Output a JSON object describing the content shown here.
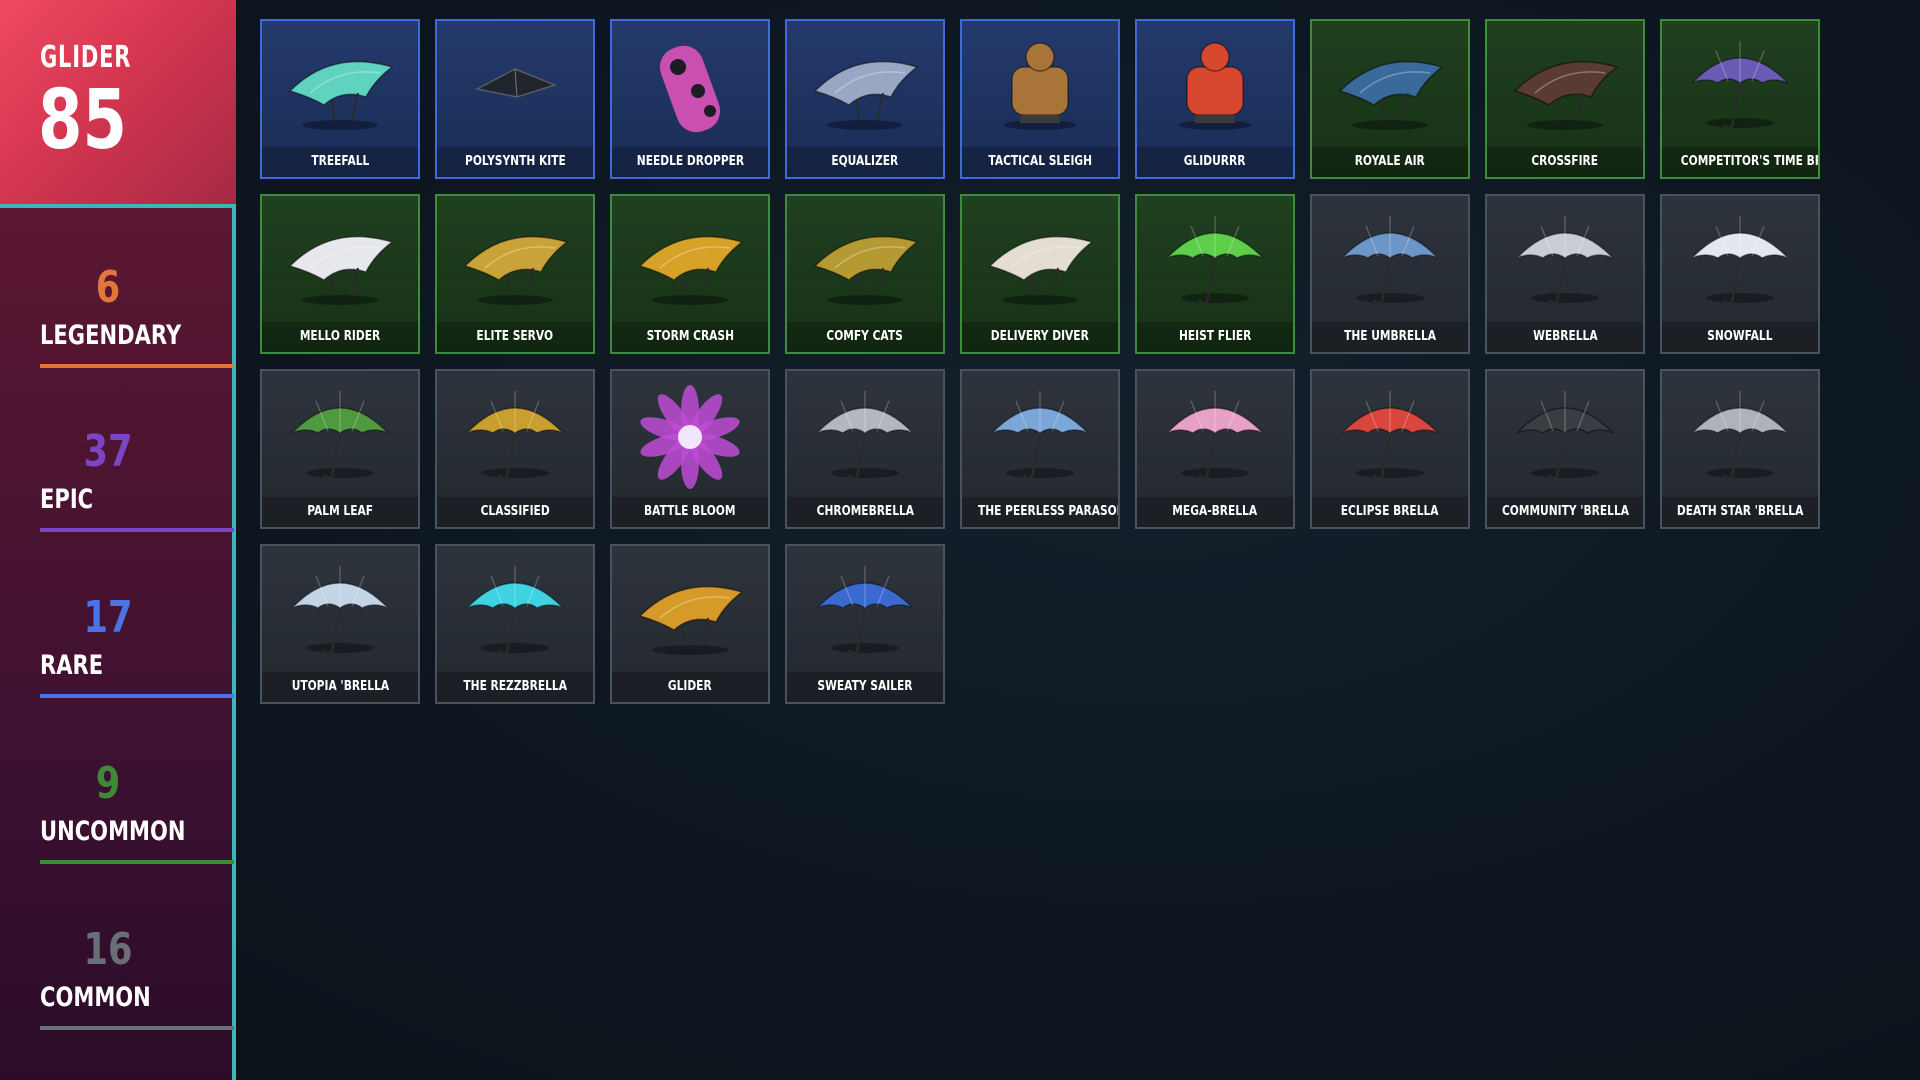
{
  "summary": {
    "label": "GLIDER",
    "total": "85"
  },
  "rarities": [
    {
      "count": "6",
      "label": "LEGENDARY",
      "color": "#e2763a"
    },
    {
      "count": "37",
      "label": "EPIC",
      "color": "#7a45c6"
    },
    {
      "count": "17",
      "label": "RARE",
      "color": "#4a74e6"
    },
    {
      "count": "9",
      "label": "UNCOMMON",
      "color": "#3f8a36"
    },
    {
      "count": "16",
      "label": "COMMON",
      "color": "#6a6f75"
    }
  ],
  "items": [
    {
      "name": "TREEFALL",
      "rarity": "rare",
      "icon": "glider-icon",
      "color": "#5fd3c0"
    },
    {
      "name": "POLYSYNTH KITE",
      "rarity": "rare",
      "icon": "kite-icon",
      "color": "#20242c"
    },
    {
      "name": "NEEDLE DROPPER",
      "rarity": "rare",
      "icon": "board-icon",
      "color": "#c94fb0"
    },
    {
      "name": "EQUALIZER",
      "rarity": "rare",
      "icon": "glider-icon",
      "color": "#9aa7c4"
    },
    {
      "name": "TACTICAL SLEIGH",
      "rarity": "rare",
      "icon": "sleigh-icon",
      "color": "#a8743a"
    },
    {
      "name": "GLIDURRR",
      "rarity": "rare",
      "icon": "sleigh-icon",
      "color": "#d7482e"
    },
    {
      "name": "ROYALE AIR",
      "rarity": "uncommon",
      "icon": "glider-icon",
      "color": "#3a6a9a"
    },
    {
      "name": "CROSSFIRE",
      "rarity": "uncommon",
      "icon": "glider-icon",
      "color": "#5a3a34"
    },
    {
      "name": "COMPETITOR'S TIME BRELLA",
      "rarity": "uncommon",
      "icon": "umbrella-icon",
      "color": "#6a5ab4"
    },
    {
      "name": "MELLO RIDER",
      "rarity": "uncommon",
      "icon": "glider-icon",
      "color": "#e6e8ec"
    },
    {
      "name": "ELITE SERVO",
      "rarity": "uncommon",
      "icon": "glider-icon",
      "color": "#c9a23a"
    },
    {
      "name": "STORM CRASH",
      "rarity": "uncommon",
      "icon": "glider-icon",
      "color": "#d6a328"
    },
    {
      "name": "COMFY CATS",
      "rarity": "uncommon",
      "icon": "glider-icon",
      "color": "#b59a34"
    },
    {
      "name": "DELIVERY DIVER",
      "rarity": "uncommon",
      "icon": "glider-icon",
      "color": "#e3ddd2"
    },
    {
      "name": "HEIST FLIER",
      "rarity": "uncommon",
      "icon": "umbrella-icon",
      "color": "#5ecf4a"
    },
    {
      "name": "THE UMBRELLA",
      "rarity": "common",
      "icon": "umbrella-icon",
      "color": "#6d96c8"
    },
    {
      "name": "WEBRELLA",
      "rarity": "common",
      "icon": "umbrella-icon",
      "color": "#c9ccd2"
    },
    {
      "name": "SNOWFALL",
      "rarity": "common",
      "icon": "umbrella-icon",
      "color": "#e4e8ee"
    },
    {
      "name": "PALM LEAF",
      "rarity": "common",
      "icon": "umbrella-icon",
      "color": "#4f9a3e"
    },
    {
      "name": "CLASSIFIED",
      "rarity": "common",
      "icon": "umbrella-icon",
      "color": "#c9a030"
    },
    {
      "name": "BATTLE BLOOM",
      "rarity": "common",
      "icon": "flower-icon",
      "color": "#c04cd6"
    },
    {
      "name": "CHROMEBRELLA",
      "rarity": "common",
      "icon": "umbrella-icon",
      "color": "#b4b8be"
    },
    {
      "name": "THE PEERLESS PARASOL",
      "rarity": "common",
      "icon": "umbrella-icon",
      "color": "#7aa6d8"
    },
    {
      "name": "MEGA-BRELLA",
      "rarity": "common",
      "icon": "umbrella-icon",
      "color": "#e7a0c6"
    },
    {
      "name": "ECLIPSE BRELLA",
      "rarity": "common",
      "icon": "umbrella-icon",
      "color": "#d8463e"
    },
    {
      "name": "COMMUNITY 'BRELLA",
      "rarity": "common",
      "icon": "umbrella-icon",
      "color": "#3a3d42"
    },
    {
      "name": "DEATH STAR 'BRELLA",
      "rarity": "common",
      "icon": "umbrella-icon",
      "color": "#aeb3b9"
    },
    {
      "name": "UTOPIA 'BRELLA",
      "rarity": "common",
      "icon": "umbrella-icon",
      "color": "#c2d4e6"
    },
    {
      "name": "THE REZZBRELLA",
      "rarity": "common",
      "icon": "umbrella-icon",
      "color": "#3fd2e0"
    },
    {
      "name": "GLIDER",
      "rarity": "common",
      "icon": "glider-icon",
      "color": "#d59a2a"
    },
    {
      "name": "SWEATY SAILER",
      "rarity": "common",
      "icon": "umbrella-icon",
      "color": "#3a6ad0"
    }
  ]
}
